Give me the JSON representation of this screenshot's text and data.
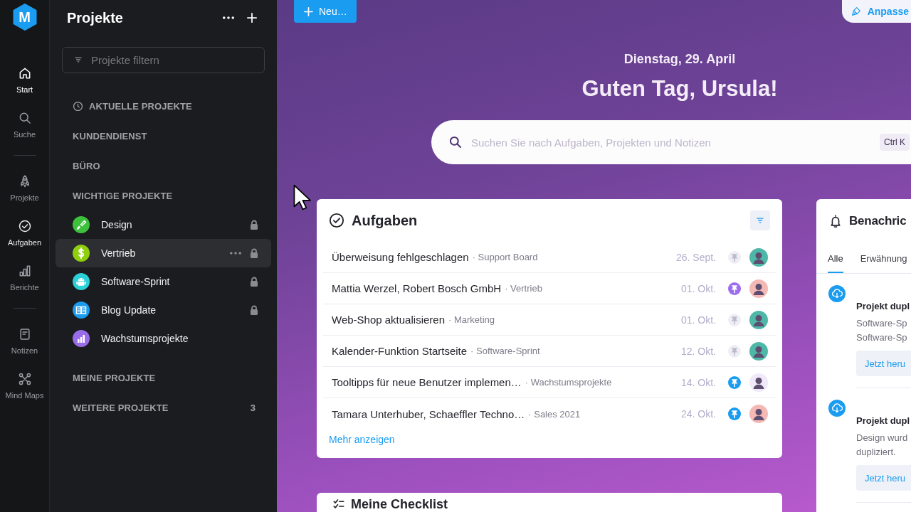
{
  "rail": {
    "logo": "M",
    "groups": [
      {
        "items": [
          {
            "label": "Start",
            "selected": true,
            "hovered": false
          },
          {
            "label": "Suche",
            "selected": false,
            "hovered": false
          }
        ]
      },
      {
        "items": [
          {
            "label": "Projekte",
            "selected": false,
            "hovered": false
          },
          {
            "label": "Aufgaben",
            "selected": false,
            "hovered": true
          },
          {
            "label": "Berichte",
            "selected": false,
            "hovered": false
          }
        ]
      },
      {
        "items": [
          {
            "label": "Notizen",
            "selected": false,
            "hovered": false
          },
          {
            "label": "Mind Maps",
            "selected": false,
            "hovered": false
          }
        ]
      }
    ]
  },
  "sidebar": {
    "title": "Projekte",
    "filter": {
      "placeholder": "Projekte filtern"
    },
    "sections": [
      {
        "kind": "recent",
        "label": "AKTUELLE PROJEKTE"
      },
      {
        "kind": "group",
        "label": "KUNDENDIENST"
      },
      {
        "kind": "group",
        "label": "BÜRO"
      },
      {
        "kind": "group",
        "label": "WICHTIGE PROJEKTE",
        "projects": [
          {
            "name": "Design",
            "color": "#3dc13c",
            "locked": true,
            "selected": false
          },
          {
            "name": "Vertrieb",
            "color": "#8fcf0e",
            "locked": true,
            "selected": true
          },
          {
            "name": "Software-Sprint",
            "color": "#2bd0d6",
            "locked": true,
            "selected": false
          },
          {
            "name": "Blog Update",
            "color": "#1a9bf0",
            "locked": true,
            "selected": false
          },
          {
            "name": "Wachstumsprojekte",
            "color": "#9a6de8",
            "locked": false,
            "selected": false
          }
        ]
      },
      {
        "kind": "group",
        "label": "MEINE PROJEKTE"
      },
      {
        "kind": "group",
        "label": "WEITERE PROJEKTE",
        "count": "3"
      }
    ]
  },
  "toolbar": {
    "new_button": "Neu…",
    "customize_button": "Anpasse"
  },
  "welcome": {
    "date": "Dienstag, 29. April",
    "greeting": "Guten Tag, Ursula!",
    "search": {
      "placeholder": "Suchen Sie nach Aufgaben, Projekten und Notizen",
      "shortcut": "Ctrl K"
    }
  },
  "tasks": {
    "title": "Aufgaben",
    "rows": [
      {
        "title": "Überweisung fehlgeschlagen",
        "project": "· Support Board",
        "due": "26. Sept.",
        "priority": {
          "active": false,
          "color": "#efeef5"
        },
        "assignee": {
          "color": "#4fb7a8"
        }
      },
      {
        "title": "Mattia Werzel, Robert Bosch GmbH",
        "project": "· Vertrieb",
        "due": "01. Okt.",
        "priority": {
          "active": true,
          "color": "#9b6ef0"
        },
        "assignee": {
          "color": "#f4b9b4"
        }
      },
      {
        "title": "Web-Shop aktualisieren",
        "project": "· Marketing",
        "due": "01. Okt.",
        "priority": {
          "active": false,
          "color": "#efeef5"
        },
        "assignee": {
          "color": "#4fb7a8"
        }
      },
      {
        "title": "Kalender-Funktion Startseite",
        "project": "· Software-Sprint",
        "due": "12. Okt.",
        "priority": {
          "active": false,
          "color": "#efeef5"
        },
        "assignee": {
          "color": "#4fb7a8"
        }
      },
      {
        "title": "Tooltipps für neue Benutzer implemen…",
        "project": "· Wachstumsprojekte",
        "due": "14. Okt.",
        "priority": {
          "active": true,
          "color": "#1a9cf0"
        },
        "assignee": {
          "color": "#efe9f8"
        }
      },
      {
        "title": "Tamara Unterhuber, Schaeffler Techno…",
        "project": "· Sales 2021",
        "due": "24. Okt.",
        "priority": {
          "active": true,
          "color": "#1a9cf0"
        },
        "assignee": {
          "color": "#f4b9b4"
        }
      }
    ],
    "more_link": "Mehr anzeigen"
  },
  "notifications": {
    "title": "Benachric",
    "tabs": [
      {
        "label": "Alle",
        "selected": true
      },
      {
        "label": "Erwähnung",
        "selected": false
      }
    ],
    "items": [
      {
        "title": "Projekt dupl",
        "lines": [
          "Software-Sp",
          "Software-Sp"
        ],
        "action": "Jetzt heru"
      },
      {
        "title": "Projekt dupl",
        "lines": [
          "Design wurd",
          "dupliziert."
        ],
        "action": "Jetzt heru"
      }
    ]
  },
  "checklists": {
    "title": "Meine Checklist"
  }
}
